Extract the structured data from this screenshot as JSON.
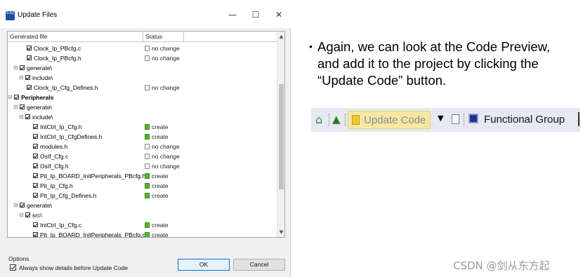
{
  "dialog": {
    "title": "Update Files",
    "app_icon_text": "S32",
    "window_buttons": {
      "minimize": "—",
      "maximize": "☐",
      "close": "✕"
    },
    "columns": {
      "file": "Generated file",
      "status": "Status"
    },
    "rows": [
      {
        "label": "Clock_Ip_PBcfg.c",
        "status": "no change"
      },
      {
        "label": "Clock_Ip_PBcfg.h",
        "status": "no change"
      },
      {
        "label": "generate\\",
        "status": ""
      },
      {
        "label": "include\\",
        "status": ""
      },
      {
        "label": "Clock_Ip_Cfg_Defines.h",
        "status": "no change"
      },
      {
        "label": "Peripherals",
        "status": ""
      },
      {
        "label": "generate\\",
        "status": ""
      },
      {
        "label": "include\\",
        "status": ""
      },
      {
        "label": "IntCtrl_Ip_Cfg.h",
        "status": "create"
      },
      {
        "label": "IntCtrl_Ip_CfgDefines.h",
        "status": "create"
      },
      {
        "label": "modules.h",
        "status": "no change"
      },
      {
        "label": "OsIf_Cfg.c",
        "status": "no change"
      },
      {
        "label": "OsIf_Cfg.h",
        "status": "no change"
      },
      {
        "label": "Pit_Ip_BOARD_InitPeripherals_PBcfg.h",
        "status": "create"
      },
      {
        "label": "Pit_Ip_Cfg.h",
        "status": "create"
      },
      {
        "label": "Pit_Ip_Cfg_Defines.h",
        "status": "create"
      },
      {
        "label": "generate\\",
        "status": ""
      },
      {
        "label": "src\\",
        "status": ""
      },
      {
        "label": "IntCtrl_Ip_Cfg.c",
        "status": "create"
      },
      {
        "label": "Pit_Ip_BOARD_InitPeripherals_PBcfg.c",
        "status": "create"
      }
    ],
    "options_label": "Options",
    "option_checkbox": "Always show details before Update Code",
    "ok_label": "OK",
    "cancel_label": "Cancel"
  },
  "slide": {
    "bullet_dot": "•",
    "bullet_text": "Again, we can look at the Code Preview, and add it to the project by clicking the “Update Code” button.",
    "toolbar": {
      "update_code_label": "Update Code",
      "functional_group_label": "Functional Group"
    }
  },
  "watermark": "CSDN @剑从东方起",
  "colors": {
    "create": "#56b52e",
    "update_highlight": "#f6e7a3",
    "toolbar_bg": "#e6e9f4"
  }
}
